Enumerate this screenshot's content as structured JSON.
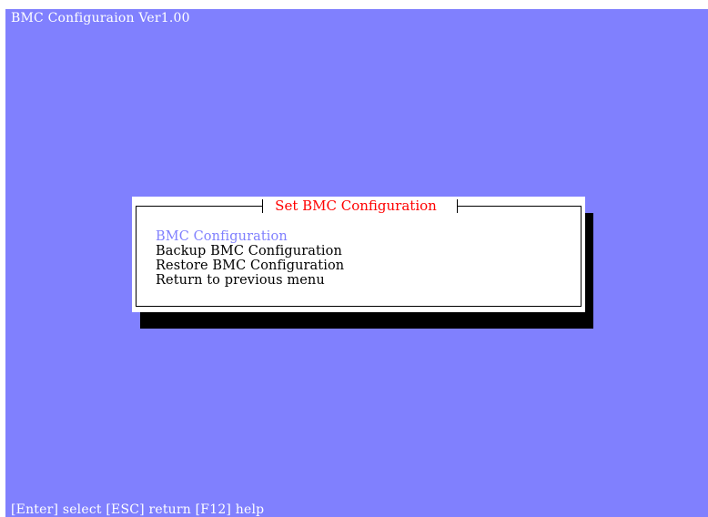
{
  "window_title": "BMC Configuraion Ver1.00",
  "dialog": {
    "title": "Set BMC Configuration",
    "items": [
      {
        "label": "BMC Configuration",
        "selected": true
      },
      {
        "label": "Backup BMC Configuration",
        "selected": false
      },
      {
        "label": "Restore BMC Configuration",
        "selected": false
      },
      {
        "label": "Return to previous menu",
        "selected": false
      }
    ]
  },
  "status_bar": "[Enter] select [ESC] return [F12] help",
  "colors": {
    "background": "#8080fe",
    "title_text": "#ffffff",
    "dialog_title": "#ff0000",
    "selected_item": "#8080fe"
  }
}
